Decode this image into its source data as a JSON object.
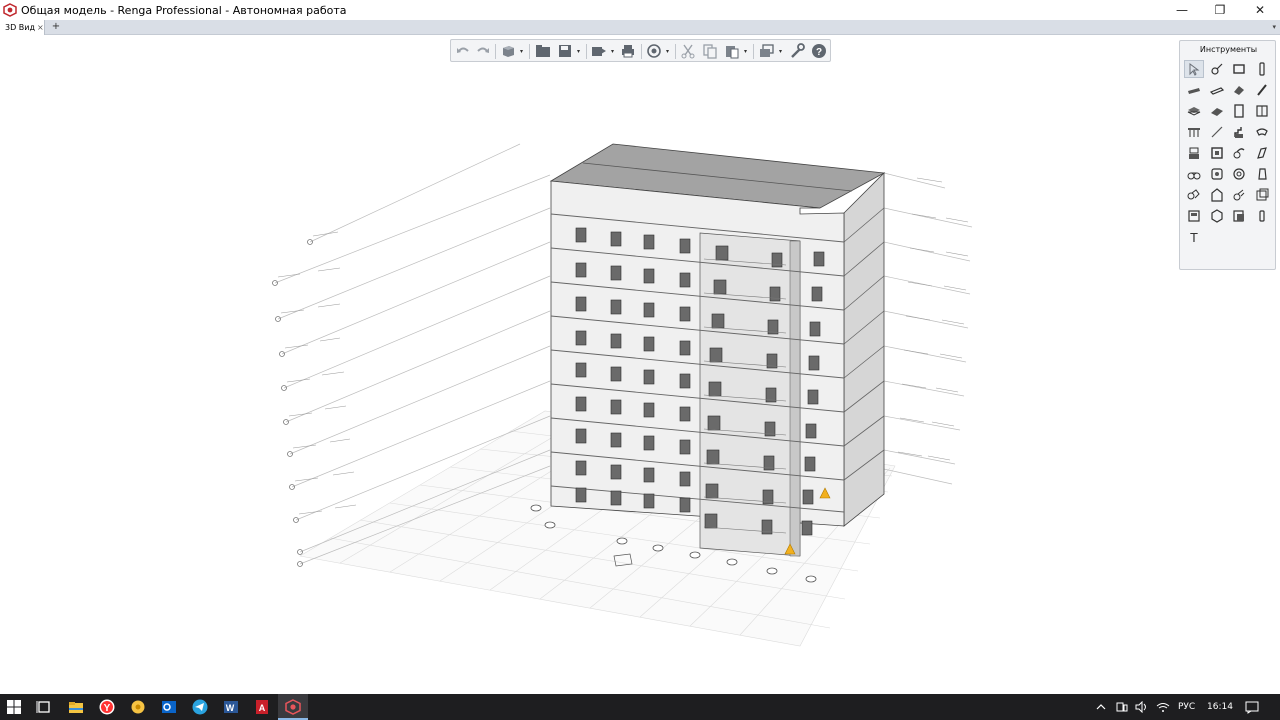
{
  "window": {
    "title": "Общая модель - Renga Professional - Автономная работа",
    "controls": {
      "minimize": "—",
      "maximize": "❐",
      "close": "✕"
    }
  },
  "tabs": {
    "items": [
      {
        "label": "3D Вид",
        "close": "×"
      }
    ],
    "add": "+",
    "menu": "▾"
  },
  "toolbar": {
    "buttons": [
      "undo-icon",
      "redo-icon",
      "view-cube-icon",
      "folder-icon",
      "save-icon",
      "export-icon",
      "print-icon",
      "orbit-icon",
      "cut-icon",
      "copy-icon",
      "paste-icon",
      "view-style-icon",
      "settings-icon",
      "help-icon"
    ],
    "dropdown_arrow": "▾"
  },
  "palette": {
    "title": "Инструменты",
    "tools": [
      "select-icon",
      "axis-icon",
      "wall-icon",
      "column-icon",
      "beam-icon",
      "slab-icon",
      "roof-icon",
      "rebar-icon",
      "floor-icon",
      "ramp-icon",
      "door-icon",
      "window-icon",
      "railing-icon",
      "line-icon",
      "stair-icon",
      "duct-icon",
      "equipment-icon",
      "panel-icon",
      "pipe-icon",
      "fitting-icon",
      "valve-icon",
      "sensor-icon",
      "pump-icon",
      "device-icon",
      "room-icon",
      "opening-icon",
      "sheet-icon",
      "element-icon",
      "assembly-icon",
      "dimension-icon",
      "level-icon",
      "section-icon",
      "text-icon"
    ],
    "text_tool_label": "T"
  },
  "taskbar": {
    "apps": [
      "windows-start-icon",
      "task-view-icon",
      "file-explorer-icon",
      "yandex-browser-icon",
      "sticky-app-icon",
      "outlook-icon",
      "telegram-icon",
      "word-icon",
      "autocad-icon",
      "renga-icon"
    ],
    "tray": {
      "language": "РУС",
      "time": "16:14"
    },
    "accent": "#0078d7"
  },
  "colors": {
    "renga_accent": "#c0282e",
    "facade": "#ececec",
    "roof": "#9a9a9a",
    "grid": "#d8d8d8"
  }
}
